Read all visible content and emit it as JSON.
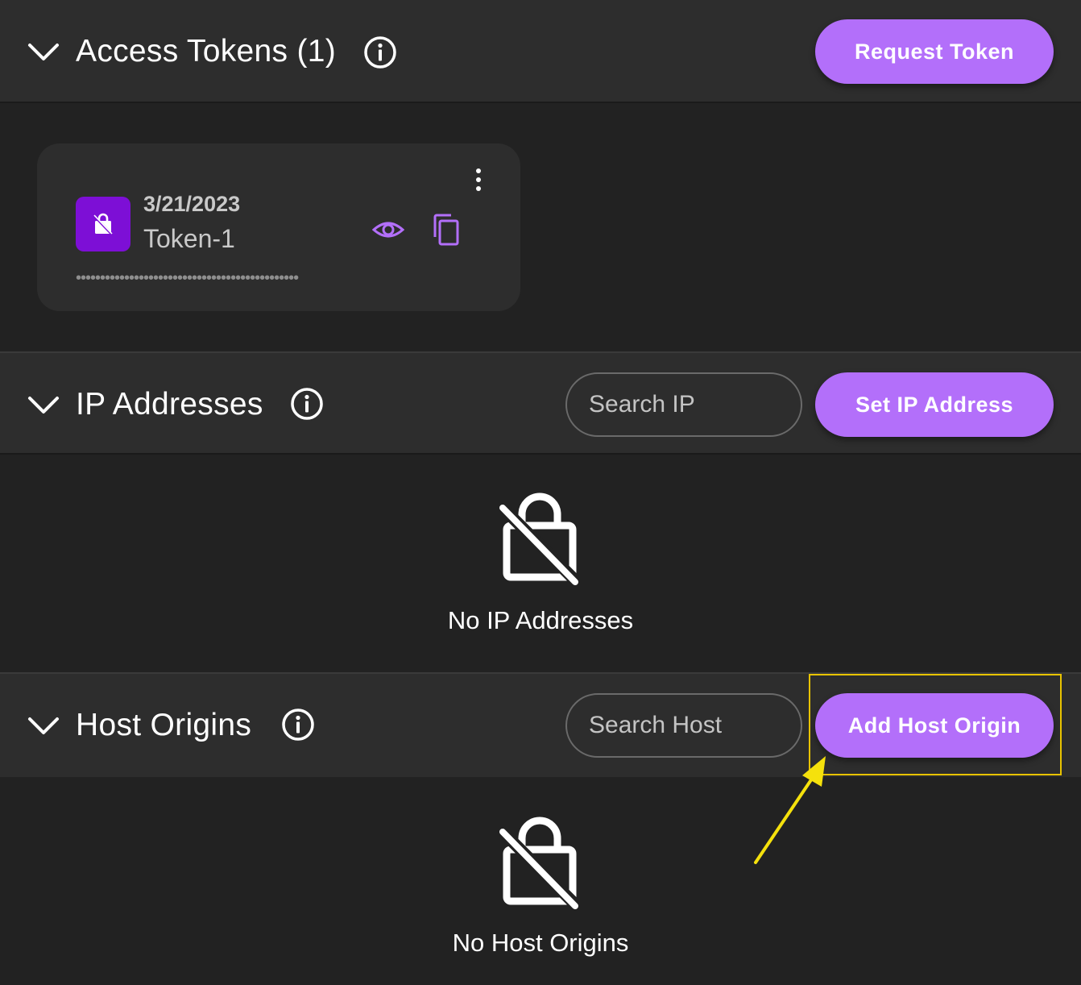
{
  "access_tokens": {
    "title": "Access Tokens (1)",
    "request_button": "Request Token",
    "tokens": [
      {
        "date": "3/21/2023",
        "name": "Token-1",
        "masked_value": "••••••••••••••••••••••••••••••••••••••••••••••"
      }
    ]
  },
  "ip_addresses": {
    "title": "IP Addresses",
    "search_placeholder": "Search IP",
    "set_button": "Set IP Address",
    "empty_text": "No IP Addresses"
  },
  "host_origins": {
    "title": "Host Origins",
    "search_placeholder": "Search Host",
    "add_button": "Add Host Origin",
    "empty_text": "No Host Origins"
  },
  "colors": {
    "accent": "#b36ffa",
    "badge": "#7d0fd6",
    "highlight": "#e8c300",
    "background": "#222222",
    "header": "#2d2d2d"
  }
}
